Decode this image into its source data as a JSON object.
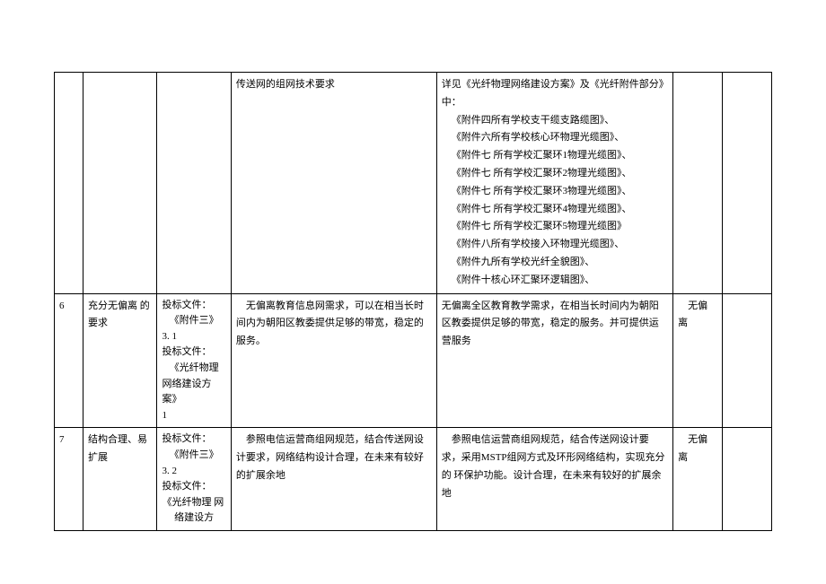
{
  "rows": [
    {
      "num": "",
      "item": "",
      "source": "",
      "requirement": "传送网的组网技术要求",
      "response_lines": [
        "详见《光纤物理网络建设方案》及《光纤附件部分》中：",
        "《附件四所有学校支干缆支路缆图》、",
        "《附件六所有学校核心环物理光缆图》、",
        "《附件七 所有学校汇聚环1物理光缆图》、",
        "《附件七 所有学校汇聚环2物理光缆图》、",
        "《附件七 所有学校汇聚环3物理光缆图》、",
        "《附件七 所有学校汇聚环4物理光缆图》、",
        "《附件七 所有学校汇聚环5物理光缆图》",
        "《附件八所有学校接入环物理光缆图》、",
        "《附件九所有学校光纤全貌图》、",
        "《附件十核心环汇聚环逻辑图》、"
      ],
      "deviation": "",
      "extra": ""
    },
    {
      "num": "6",
      "item": "充分无偏离 的要求",
      "source_lines": [
        "投标文件：",
        "《附件三》",
        "3. 1",
        "投标文件：",
        "《光纤物理",
        "网络建设方 案》",
        "1"
      ],
      "requirement": "无偏离教育信息网需求，可以在相当长时间内为朝阳区教委提供足够的带宽，稳定的服务。",
      "response": "无偏离全区教育教学需求，在相当长时间内为朝阳区教委提供足够的带宽，稳定的服务。并可提供运营服务",
      "deviation": "无偏离",
      "extra": ""
    },
    {
      "num": "7",
      "item": "结构合理、易扩展",
      "source_lines": [
        "投标文件：",
        "《附件三》",
        "3. 2",
        "投标文件：",
        "《光纤物理 网",
        "络建设方"
      ],
      "requirement": "参照电信运营商组网规范，结合传送网设计要求，网络结构设计合理，在未来有较好的扩展余地",
      "response": "参照电信运营商组网规范，结合传送网设计要求，采用MSTP组网方式及环形网络结构，实现充分的 环保护功能。设计合理，在未来有较好的扩展余地",
      "deviation": "无偏离",
      "extra": ""
    }
  ]
}
